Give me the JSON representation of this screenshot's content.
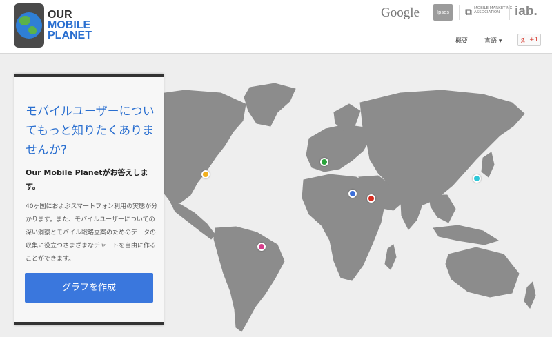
{
  "header": {
    "logo": {
      "line1": "OUR",
      "line2": "MOBILE",
      "line3": "PLANET"
    },
    "partners": {
      "google": "Google",
      "ipsos": "Ipsos",
      "mma": "MOBILE MARKETING ASSOCIATION",
      "iab": "iab."
    },
    "nav": {
      "overview": "概要",
      "language": "言語 ▾",
      "gplus_g": "g",
      "gplus_plus": "+1"
    }
  },
  "panel": {
    "heading": "モバイルユーザーについてもっと知りたくありませんか?",
    "subheading": "Our Mobile Planetがお答えします。",
    "body": "40ヶ国におよぶスマートフォン利用の実態が分かります。また、モバイルユーザーについての深い洞察とモバイル戦略立案のためのデータの収集に役立つさまざまなチャートを自由に作ることができます。",
    "cta_label": "グラフを作成"
  },
  "colors": {
    "accent": "#3a77dd",
    "map_land": "#8c8c8c",
    "marker_orange": "#f2b01e",
    "marker_green": "#2aa33a",
    "marker_blue": "#3c6fd8",
    "marker_red": "#d62d20",
    "marker_cyan": "#2ec8d8",
    "marker_pink": "#d63c8a"
  },
  "icons": {
    "logo": "globe-phone-icon",
    "mma": "mma-logo-icon",
    "gplus": "google-plus-one-icon"
  }
}
